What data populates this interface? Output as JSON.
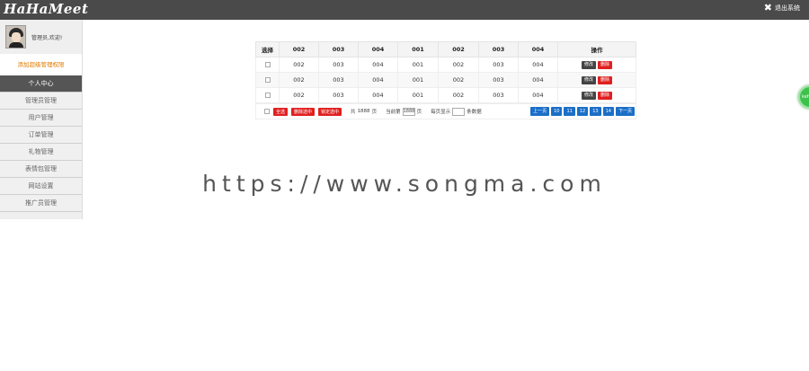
{
  "app": {
    "logo": "HaHaMeet",
    "exit_label": "退出系统"
  },
  "sidebar": {
    "username": "管理员,欢迎!",
    "notice": "添加超级管理权限",
    "items": [
      {
        "label": "个人中心",
        "active": true
      },
      {
        "label": "管理员管理"
      },
      {
        "label": "用户管理"
      },
      {
        "label": "订单管理"
      },
      {
        "label": "礼物管理"
      },
      {
        "label": "表情包管理"
      },
      {
        "label": "网站设置"
      },
      {
        "label": "推广员管理"
      }
    ]
  },
  "table": {
    "headers": [
      "选择",
      "002",
      "003",
      "004",
      "001",
      "002",
      "003",
      "004",
      "操作"
    ],
    "rows": [
      [
        "002",
        "003",
        "004",
        "001",
        "002",
        "003",
        "004"
      ],
      [
        "002",
        "003",
        "004",
        "001",
        "002",
        "003",
        "004"
      ],
      [
        "002",
        "003",
        "004",
        "001",
        "002",
        "003",
        "004"
      ]
    ],
    "edit_label": "修改",
    "delete_label": "删除"
  },
  "footer": {
    "select_all": "全选",
    "delete_selected": "删除选中",
    "lock_selected": "锁定选中",
    "total_prefix": "共",
    "total_count": "1888",
    "total_suffix": "页",
    "current_prefix": "当前第",
    "current_page": "1888",
    "current_suffix": "页",
    "per_page_label": "每页显示",
    "per_page_value": "",
    "per_page_suffix": "条数据",
    "prev": "上一页",
    "pages": [
      "10",
      "11",
      "12",
      "13",
      "14"
    ],
    "next": "下一页"
  },
  "watermark": "https://www.songma.com",
  "float_button": {
    "label": "kefu"
  }
}
